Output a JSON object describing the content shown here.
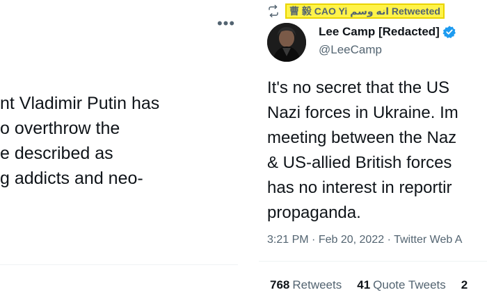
{
  "left_tweet": {
    "text_lines": [
      "nt Vladimir Putin has",
      "o overthrow the",
      "e described as",
      "g addicts and neo-"
    ],
    "more_icon": "more-horizontal-icon"
  },
  "right_tweet": {
    "retweet_icon": "retweet-icon",
    "retweeted_by": "曹 毅 CAO Yi انه وسم Retweeted",
    "author": {
      "name": "Lee Camp [Redacted]",
      "handle": "@LeeCamp",
      "verified_icon": "verified-badge-icon",
      "avatar": "avatar"
    },
    "text_lines": [
      "It's no secret that the US",
      "Nazi forces in Ukraine. Im",
      "meeting between the Naz",
      "& US-allied British forces",
      "has no interest in reportir",
      "propaganda."
    ],
    "time": "3:21 PM",
    "separator": "·",
    "date": "Feb 20, 2022",
    "source": "Twitter Web A",
    "stats": [
      {
        "count": "768",
        "label": "Retweets"
      },
      {
        "count": "41",
        "label": "Quote Tweets"
      },
      {
        "count": "2",
        "label": ""
      }
    ]
  },
  "colors": {
    "text_primary": "#0f1419",
    "text_secondary": "#536471",
    "highlight": "#fff34a",
    "verified_blue": "#1d9bf0",
    "divider": "#eff3f4"
  }
}
